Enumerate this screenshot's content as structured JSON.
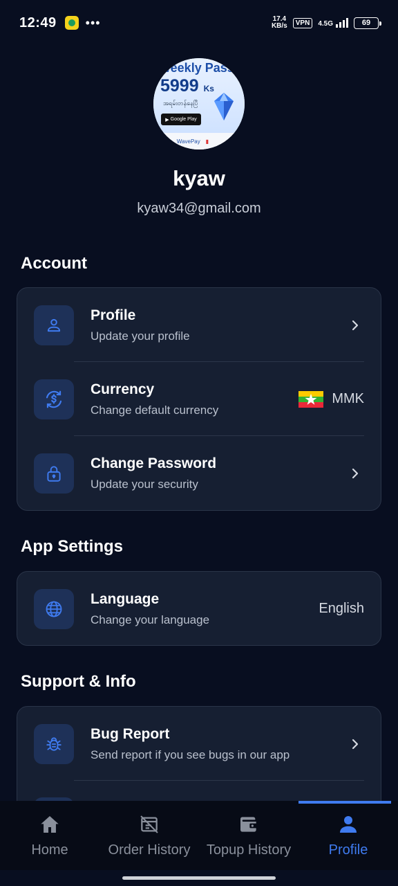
{
  "status_bar": {
    "time": "12:49",
    "dots": "•••",
    "net_speed_value": "17.4",
    "net_speed_unit": "KB/s",
    "vpn": "VPN",
    "network": "4.5G",
    "battery": "69"
  },
  "avatar": {
    "promo_title": "Weekly Pass",
    "promo_price": "5999",
    "promo_currency": "Ks",
    "promo_myanmar": "အရမ်းတန်နေပြီ",
    "promo_store": "Google Play",
    "promo_pay_left": "Pay",
    "promo_pay_mid": "WavePay"
  },
  "user": {
    "name": "kyaw",
    "email": "kyaw34@gmail.com"
  },
  "sections": {
    "account": {
      "title": "Account",
      "items": [
        {
          "title": "Profile",
          "subtitle": "Update your profile"
        },
        {
          "title": "Currency",
          "subtitle": "Change default currency",
          "value": "MMK"
        },
        {
          "title": "Change Password",
          "subtitle": "Update your security"
        }
      ]
    },
    "app_settings": {
      "title": "App Settings",
      "items": [
        {
          "title": "Language",
          "subtitle": "Change your language",
          "value": "English"
        }
      ]
    },
    "support": {
      "title": "Support & Info",
      "items": [
        {
          "title": "Bug Report",
          "subtitle": "Send report if you see bugs in our app"
        }
      ]
    }
  },
  "nav": {
    "items": [
      {
        "label": "Home",
        "icon": "home-icon"
      },
      {
        "label": "Order History",
        "icon": "order-history-icon"
      },
      {
        "label": "Topup History",
        "icon": "wallet-icon"
      },
      {
        "label": "Profile",
        "icon": "profile-icon",
        "active": true
      }
    ]
  },
  "colors": {
    "background": "#080e20",
    "card": "#161f32",
    "accent": "#3f7bf0",
    "icon_tile": "#1e3158"
  }
}
